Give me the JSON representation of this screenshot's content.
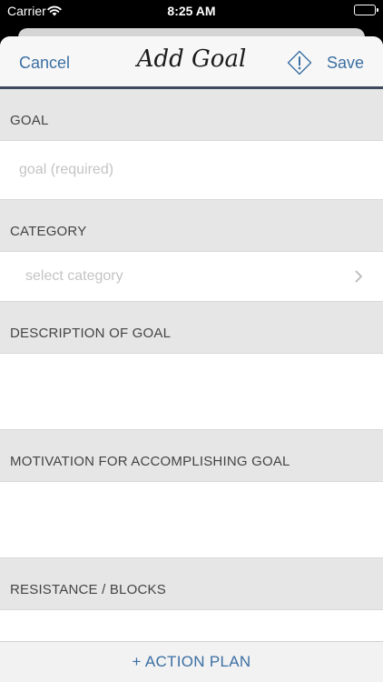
{
  "status_bar": {
    "carrier": "Carrier",
    "time": "8:25 AM"
  },
  "navbar": {
    "cancel_label": "Cancel",
    "title": "Add Goal",
    "save_label": "Save",
    "info_icon": "warning-diamond-icon"
  },
  "sections": {
    "goal": {
      "header": "GOAL",
      "placeholder": "goal (required)"
    },
    "category": {
      "header": "CATEGORY",
      "placeholder": "select category"
    },
    "description": {
      "header": "DESCRIPTION OF GOAL"
    },
    "motivation": {
      "header": "MOTIVATION FOR ACCOMPLISHING GOAL"
    },
    "resistance": {
      "header": "RESISTANCE / BLOCKS"
    }
  },
  "bottom_bar": {
    "label": "+ ACTION PLAN"
  },
  "colors": {
    "accent": "#3b6fa3",
    "nav_border": "#3d4a5e",
    "section_bg": "#e6e6e6"
  }
}
